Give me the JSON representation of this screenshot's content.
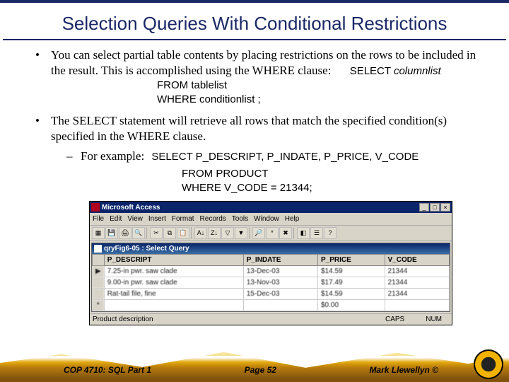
{
  "title": "Selection Queries With Conditional Restrictions",
  "bullet1_text": "You can select partial table contents by placing restrictions on the rows to be included in the result.  This is accomplished using the WHERE clause:",
  "syntax": {
    "line1_kw": "SELECT ",
    "line1_it": "columnlist",
    "line2_kw": "FROM ",
    "line2_it": "tablelist",
    "line3_kw": "WHERE ",
    "line3_it": "conditionlist ",
    "line3_end": ";"
  },
  "bullet2_text": "The SELECT statement will retrieve all rows that match the specified condition(s) specified in the WHERE clause.",
  "example_label": "For example:",
  "example": {
    "line1": "SELECT P_DESCRIPT, P_INDATE, P_PRICE, V_CODE",
    "line2": "FROM PRODUCT",
    "line3": "WHERE V_CODE = 21344;"
  },
  "access": {
    "app_title": "Microsoft Access",
    "menus": [
      "File",
      "Edit",
      "View",
      "Insert",
      "Format",
      "Records",
      "Tools",
      "Window",
      "Help"
    ],
    "query_title": "qryFig6-05 : Select Query",
    "columns": [
      "P_DESCRIPT",
      "P_INDATE",
      "P_PRICE",
      "V_CODE"
    ],
    "rows": [
      [
        "7.25-in pwr. saw clade",
        "13-Dec-03",
        "$14.59",
        "21344"
      ],
      [
        "9.00-in pwr. saw clade",
        "13-Nov-03",
        "$17.49",
        "21344"
      ],
      [
        "Rat-tail file, fine",
        "15-Dec-03",
        "$14.59",
        "21344"
      ],
      [
        "",
        "",
        "$0.00",
        ""
      ]
    ],
    "status_left": "Product description",
    "status_caps": "CAPS",
    "status_num": "NUM"
  },
  "footer": {
    "left": "COP 4710: SQL Part 1",
    "center": "Page 52",
    "right": "Mark Llewellyn ©"
  }
}
